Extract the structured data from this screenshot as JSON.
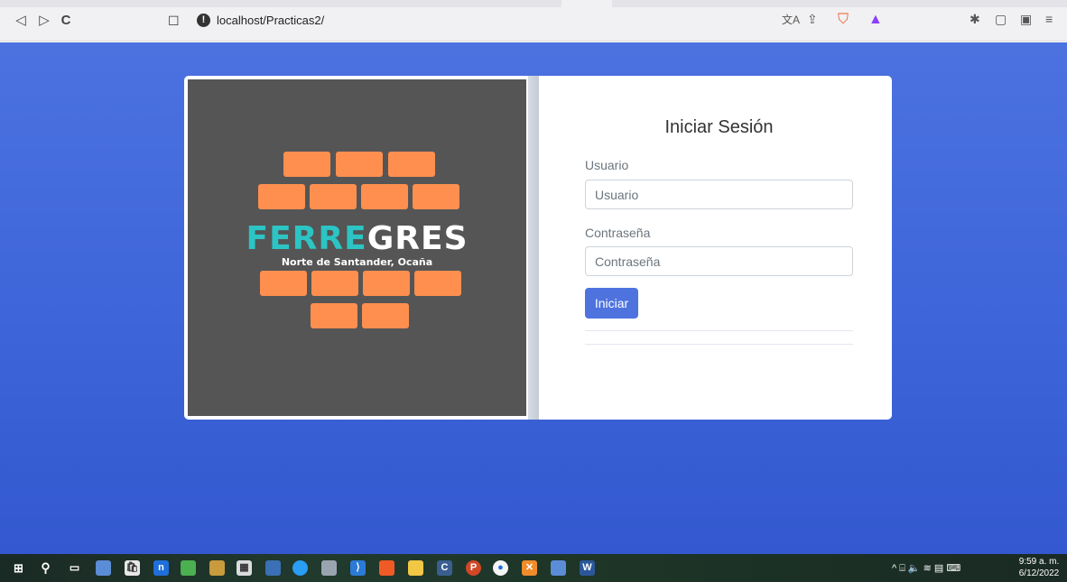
{
  "browser": {
    "url": "localhost/Practicas2/",
    "info_glyph": "!",
    "back_glyph": "◁",
    "forward_glyph": "▷",
    "reload_glyph": "C",
    "bookmark_glyph": "☐",
    "translate_glyph": "文A",
    "share_glyph": "⇪",
    "brave_glyph": "⛉",
    "rewards_glyph": "▲",
    "extensions_glyph": "✱",
    "sidebar_glyph": "▢",
    "wallet_glyph": "▣",
    "menu_glyph": "≡"
  },
  "logo": {
    "brand_part1": "FERRE",
    "brand_part2": "GRES",
    "tagline": "Norte de Santander, Ocaña",
    "brick_color": "#ff8f4f",
    "panel_color": "#555555"
  },
  "login": {
    "title": "Iniciar Sesión",
    "user_label": "Usuario",
    "user_placeholder": "Usuario",
    "password_label": "Contraseña",
    "password_placeholder": "Contraseña",
    "submit_label": "Iniciar"
  },
  "taskbar": {
    "time": "9:59 a. m.",
    "date": "6/12/2022",
    "tray_text": "^ ⌸ 🔈 ≋ ▤ ⌨"
  },
  "colors": {
    "accent": "#4e73df",
    "page_bg": "#4a6fdf"
  }
}
